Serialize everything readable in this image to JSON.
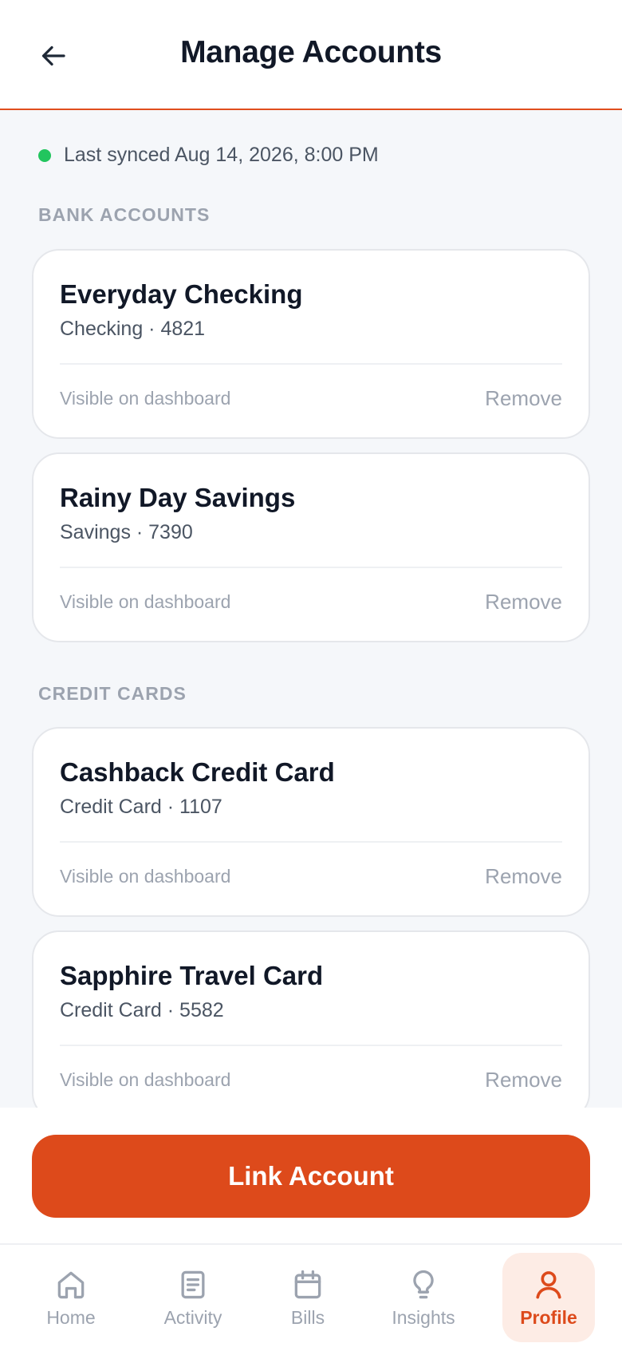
{
  "header": {
    "title": "Manage Accounts",
    "back_icon": "arrow-left-icon"
  },
  "sync": {
    "status_color": "#22c55e",
    "text": "Last synced Aug 14, 2026, 8:00 PM"
  },
  "sections": {
    "bank": {
      "label": "BANK ACCOUNTS",
      "accounts": [
        {
          "name": "Everyday Checking",
          "meta": "Checking · 4821",
          "visibility": "Visible on dashboard",
          "action": "Remove"
        },
        {
          "name": "Rainy Day Savings",
          "meta": "Savings · 7390",
          "visibility": "Visible on dashboard",
          "action": "Remove"
        }
      ]
    },
    "credit": {
      "label": "CREDIT CARDS",
      "accounts": [
        {
          "name": "Cashback Credit Card",
          "meta": "Credit Card · 1107",
          "visibility": "Visible on dashboard",
          "action": "Remove"
        },
        {
          "name": "Sapphire Travel Card",
          "meta": "Credit Card · 5582",
          "visibility": "Visible on dashboard",
          "action": "Remove"
        }
      ]
    }
  },
  "primary_action": {
    "label": "Link Account",
    "color": "#dd4a1b"
  },
  "tabs": [
    {
      "label": "Home",
      "icon": "home-icon",
      "active": false
    },
    {
      "label": "Activity",
      "icon": "document-icon",
      "active": false
    },
    {
      "label": "Bills",
      "icon": "calendar-icon",
      "active": false
    },
    {
      "label": "Insights",
      "icon": "lightbulb-icon",
      "active": false
    },
    {
      "label": "Profile",
      "icon": "user-icon",
      "active": true
    }
  ]
}
